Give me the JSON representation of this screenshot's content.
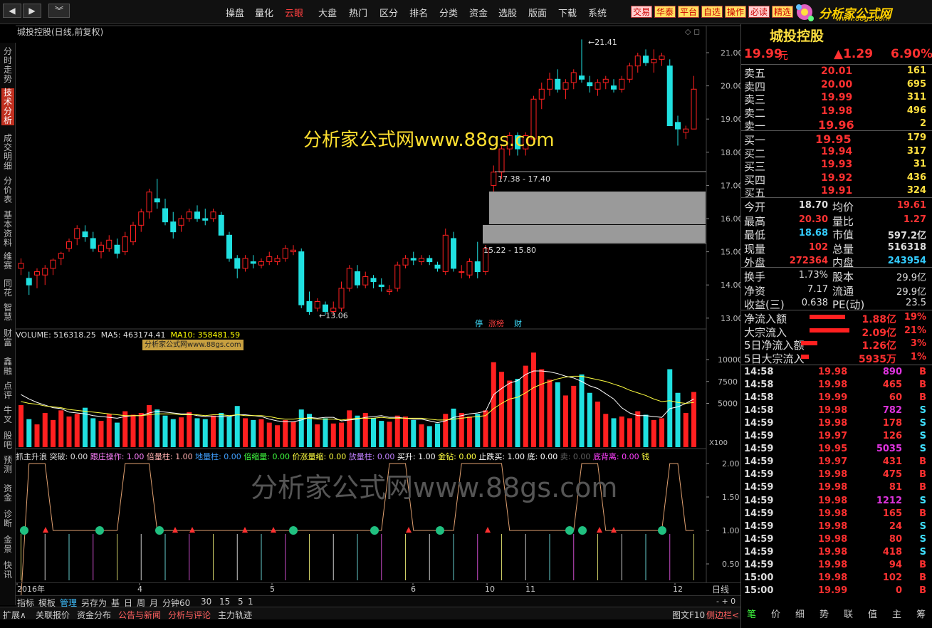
{
  "topbar": {
    "menu": [
      "操盘",
      "量化",
      "云眼",
      "大盘",
      "热门",
      "区分",
      "排名",
      "分类",
      "资金",
      "选股",
      "版面",
      "下载",
      "系统"
    ],
    "active_menu": "云眼",
    "quick": [
      "交易",
      "华泰",
      "平台",
      "自选",
      "操作",
      "必读",
      "精选"
    ],
    "logo": "分析家公式网",
    "logo_url": "www.88gs.com"
  },
  "sidebar": [
    "分时走势",
    "技术分析",
    "成交明细",
    "分价表",
    "基本资料",
    "维赛",
    "同花",
    "智慧",
    "财富",
    "鑫融",
    "点评",
    "牛叉",
    "股吧",
    "预测",
    "资金",
    "诊断",
    "金景",
    "快讯"
  ],
  "sidebar_active": "技术分析",
  "chart_title": "城投控股(日线,前复权)",
  "watermark": "分析家公式网www.88gs.com",
  "watermark2": "分析家公式网www.88gs.com",
  "volume_header": {
    "vol": "VOLUME: 516318.25",
    "ma5": "MA5: 463174.41",
    "ma10": "MA10: 358481.59",
    "badge": "分析家公式网www.88gs.com"
  },
  "annotations": {
    "high": "21.41",
    "low": "13.06",
    "zone1": "17.38 - 17.40",
    "zone2": "15.22 - 15.80",
    "x100": "X100"
  },
  "event_marks": [
    "停",
    "涨榜",
    "财"
  ],
  "indicator_header": [
    "抓主升浪",
    "突破: 0.00",
    "跟庄操作: 1.00",
    "倍量柱: 1.00",
    "地量柱: 0.00",
    "倍缩量: 0.00",
    "价涨量缩: 0.00",
    "放量柱: 0.00",
    "买升: 1.00",
    "金钻: 0.00",
    "止跌买: 1.00",
    "底: 0.00",
    "卖: 0.00",
    "底背离: 0.00",
    "钱"
  ],
  "chart_data": {
    "type": "candlestick",
    "price_ticks": [
      "21.00",
      "20.00",
      "19.00",
      "18.00",
      "17.00",
      "16.00",
      "15.00",
      "14.00",
      "13.00"
    ],
    "volume_ticks": [
      "10000",
      "7500",
      "5000"
    ],
    "indicator_ticks": [
      "2.00",
      "1.50",
      "1.00",
      "0.50"
    ],
    "x_labels": [
      "2016年",
      "4",
      "5",
      "6",
      "10",
      "11",
      "12"
    ],
    "ohlc": [
      [
        14.5,
        14.8,
        14.3,
        14.65
      ],
      [
        14.2,
        14.4,
        13.7,
        14.0
      ],
      [
        14.3,
        14.5,
        13.9,
        14.4
      ],
      [
        14.3,
        14.6,
        14.0,
        14.5
      ],
      [
        14.5,
        14.8,
        14.3,
        14.75
      ],
      [
        14.8,
        15.0,
        14.6,
        14.95
      ],
      [
        15.1,
        15.4,
        15.0,
        15.3
      ],
      [
        15.4,
        15.8,
        15.2,
        15.7
      ],
      [
        15.6,
        15.8,
        15.3,
        15.45
      ],
      [
        15.4,
        15.6,
        15.0,
        15.1
      ],
      [
        15.0,
        15.3,
        14.8,
        15.2
      ],
      [
        15.1,
        15.5,
        15.0,
        15.35
      ],
      [
        15.2,
        15.4,
        14.8,
        14.95
      ],
      [
        15.0,
        15.6,
        14.9,
        15.45
      ],
      [
        15.3,
        15.9,
        15.2,
        15.8
      ],
      [
        15.8,
        16.3,
        15.6,
        16.2
      ],
      [
        16.2,
        16.9,
        16.0,
        16.8
      ],
      [
        16.6,
        17.2,
        16.3,
        16.5
      ],
      [
        16.3,
        16.6,
        15.8,
        15.9
      ],
      [
        15.9,
        16.2,
        15.4,
        15.6
      ],
      [
        15.8,
        16.1,
        15.6,
        16.0
      ],
      [
        16.0,
        16.3,
        15.9,
        16.2
      ],
      [
        16.2,
        16.4,
        15.9,
        16.0
      ],
      [
        16.0,
        16.3,
        15.8,
        15.95
      ],
      [
        16.0,
        16.3,
        15.9,
        16.2
      ],
      [
        16.1,
        16.2,
        15.5,
        15.5
      ],
      [
        15.5,
        15.6,
        14.7,
        14.8
      ],
      [
        14.8,
        14.9,
        14.2,
        14.5
      ],
      [
        14.5,
        14.9,
        14.4,
        14.8
      ],
      [
        14.7,
        14.9,
        14.5,
        14.65
      ],
      [
        14.6,
        14.8,
        14.5,
        14.7
      ],
      [
        14.7,
        15.0,
        14.6,
        14.85
      ],
      [
        14.7,
        14.9,
        14.6,
        14.8
      ],
      [
        14.8,
        15.2,
        14.7,
        15.1
      ],
      [
        15.0,
        15.2,
        14.9,
        15.05
      ],
      [
        15.0,
        15.1,
        13.3,
        13.4
      ],
      [
        13.5,
        13.8,
        13.1,
        13.2
      ],
      [
        13.3,
        13.6,
        13.2,
        13.5
      ],
      [
        13.4,
        13.5,
        13.1,
        13.2
      ],
      [
        13.2,
        13.5,
        13.1,
        13.3
      ],
      [
        13.3,
        14.1,
        13.2,
        13.9
      ],
      [
        13.9,
        14.6,
        13.8,
        14.5
      ],
      [
        14.4,
        14.6,
        13.9,
        14.0
      ],
      [
        14.0,
        14.4,
        13.9,
        14.25
      ],
      [
        14.2,
        14.3,
        13.9,
        14.1
      ],
      [
        14.0,
        14.2,
        13.8,
        13.95
      ],
      [
        13.8,
        14.0,
        13.7,
        13.85
      ],
      [
        13.9,
        14.7,
        13.8,
        14.6
      ],
      [
        14.6,
        14.9,
        14.5,
        14.8
      ],
      [
        14.8,
        15.0,
        14.6,
        14.75
      ],
      [
        14.7,
        14.9,
        14.6,
        14.8
      ],
      [
        14.8,
        14.9,
        14.6,
        14.7
      ],
      [
        14.6,
        14.7,
        14.4,
        14.5
      ],
      [
        14.4,
        15.7,
        14.3,
        15.5
      ],
      [
        15.4,
        15.6,
        14.4,
        14.5
      ],
      [
        14.4,
        14.6,
        14.2,
        14.4
      ],
      [
        14.3,
        14.8,
        14.2,
        14.7
      ],
      [
        14.7,
        15.3,
        14.2,
        14.4
      ],
      [
        14.4,
        15.2,
        14.3,
        15.1
      ],
      [
        17.0,
        17.6,
        16.8,
        17.4
      ],
      [
        17.4,
        18.2,
        17.2,
        18.1
      ],
      [
        18.1,
        18.6,
        17.9,
        18.5
      ],
      [
        18.5,
        18.6,
        17.9,
        18.1
      ],
      [
        18.1,
        18.6,
        17.9,
        18.5
      ],
      [
        18.4,
        19.7,
        18.3,
        19.6
      ],
      [
        19.6,
        20.1,
        19.3,
        19.9
      ],
      [
        19.9,
        20.4,
        19.7,
        20.2
      ],
      [
        20.2,
        20.5,
        19.8,
        19.9
      ],
      [
        19.9,
        20.2,
        19.6,
        20.1
      ],
      [
        20.1,
        20.5,
        19.9,
        20.4
      ],
      [
        20.3,
        21.4,
        20.1,
        20.2
      ],
      [
        20.1,
        20.3,
        19.8,
        20.0
      ],
      [
        19.9,
        20.2,
        19.7,
        20.1
      ],
      [
        20.1,
        20.3,
        19.9,
        20.2
      ],
      [
        20.0,
        20.2,
        19.8,
        19.9
      ],
      [
        19.9,
        20.3,
        19.8,
        20.2
      ],
      [
        20.2,
        20.7,
        20.1,
        20.6
      ],
      [
        20.6,
        21.0,
        20.4,
        20.9
      ],
      [
        20.9,
        21.1,
        20.6,
        20.7
      ],
      [
        20.7,
        21.1,
        20.4,
        20.8
      ],
      [
        20.8,
        21.0,
        20.6,
        20.9
      ],
      [
        20.6,
        20.8,
        18.8,
        18.8
      ],
      [
        18.9,
        19.1,
        18.2,
        18.7
      ],
      [
        18.6,
        18.8,
        18.4,
        18.7
      ],
      [
        18.7,
        20.3,
        18.7,
        19.9
      ]
    ],
    "volume": [
      4800,
      3200,
      2600,
      3900,
      3100,
      4200,
      3500,
      3800,
      4500,
      3300,
      3000,
      3800,
      2800,
      4100,
      3700,
      3900,
      4800,
      4300,
      3600,
      3200,
      3400,
      4000,
      3300,
      3200,
      3600,
      3900,
      3500,
      4700,
      3300,
      3100,
      3200,
      2800,
      2500,
      3100,
      2900,
      4300,
      3800,
      2600,
      3300,
      2700,
      2800,
      4200,
      3600,
      3900,
      3300,
      3000,
      2900,
      3600,
      3500,
      3100,
      2600,
      2400,
      2700,
      3800,
      4400,
      3900,
      3500,
      3800,
      4200,
      9700,
      8600,
      7600,
      7800,
      9300,
      10800,
      8900,
      7700,
      7400,
      5900,
      7000,
      8300,
      6200,
      5200,
      3800,
      3300,
      3500,
      3300,
      4100,
      3700,
      3100,
      3300,
      8900,
      6200,
      3900,
      6300
    ],
    "ma5": [
      6000,
      5500,
      5100,
      4800,
      4500,
      4400,
      4000,
      3900,
      3800,
      3600,
      3500,
      3400,
      3300,
      3500,
      3600,
      3600,
      3900,
      4100,
      4000,
      3900,
      3800,
      3800,
      3600,
      3500,
      3500,
      3500,
      3500,
      3700,
      3700,
      3600,
      3500,
      3200,
      3000,
      2900,
      2900,
      3100,
      3400,
      3300,
      3400,
      3400,
      3000,
      3100,
      3200,
      3400,
      3500,
      3600,
      3400,
      3400,
      3300,
      3200,
      3200,
      3000,
      2800,
      3000,
      3400,
      3600,
      3800,
      3900,
      4100,
      6000,
      6700,
      7300,
      7600,
      8300,
      8700,
      8700,
      8600,
      8400,
      8100,
      7900,
      7500,
      7000,
      6700,
      6100,
      5500,
      4500,
      3900,
      3600,
      3600,
      3500,
      3400,
      4400,
      4600,
      5000,
      5500
    ],
    "ma10": [
      5200,
      5000,
      4900,
      4700,
      4600,
      4500,
      4300,
      4200,
      4100,
      4000,
      3900,
      3800,
      3700,
      3600,
      3600,
      3600,
      3700,
      3800,
      3800,
      3800,
      3700,
      3700,
      3700,
      3600,
      3700,
      3700,
      3600,
      3700,
      3600,
      3600,
      3600,
      3500,
      3300,
      3200,
      3200,
      3300,
      3300,
      3200,
      3200,
      3200,
      3100,
      3200,
      3300,
      3300,
      3300,
      3400,
      3300,
      3300,
      3300,
      3300,
      3300,
      3200,
      3100,
      3100,
      3200,
      3300,
      3400,
      3500,
      3600,
      4400,
      5000,
      5500,
      5700,
      6200,
      6800,
      7200,
      7500,
      7800,
      8000,
      8100,
      8100,
      7900,
      7700,
      7500,
      7200,
      6900,
      6500,
      6200,
      5900,
      5500,
      5200,
      5300,
      5100,
      5000,
      5100
    ],
    "indicator": [
      0,
      2,
      2,
      2,
      1,
      1,
      1,
      1,
      1,
      1,
      1,
      1,
      1,
      2,
      2,
      2,
      2,
      1,
      1,
      1,
      1,
      1,
      1,
      1,
      1,
      1,
      1,
      1,
      1,
      1,
      1,
      1,
      1,
      1,
      1,
      1,
      1,
      1,
      1,
      1,
      1,
      1,
      1,
      1,
      1,
      1,
      2,
      2,
      2,
      1,
      1,
      1,
      1,
      1,
      1,
      2,
      2,
      2,
      2,
      2,
      2,
      1,
      1,
      1,
      1,
      1,
      1,
      1,
      1,
      1,
      2,
      2,
      2,
      1,
      1,
      1,
      1,
      1,
      1,
      1,
      1,
      2,
      2,
      1,
      1
    ]
  },
  "right_panel": {
    "title": "城投控股",
    "price": "19.99",
    "price_unit": "元",
    "change": "▲1.29",
    "change_pct": "6.90%",
    "asks": [
      {
        "label": "卖五",
        "price": "20.01",
        "vol": "161"
      },
      {
        "label": "卖四",
        "price": "20.00",
        "vol": "695"
      },
      {
        "label": "卖三",
        "price": "19.99",
        "vol": "311"
      },
      {
        "label": "卖二",
        "price": "19.98",
        "vol": "496"
      },
      {
        "label": "卖一",
        "price": "19.96",
        "vol": "2"
      }
    ],
    "bids": [
      {
        "label": "买一",
        "price": "19.95",
        "vol": "179"
      },
      {
        "label": "买二",
        "price": "19.94",
        "vol": "317"
      },
      {
        "label": "买三",
        "price": "19.93",
        "vol": "31"
      },
      {
        "label": "买四",
        "price": "19.92",
        "vol": "436"
      },
      {
        "label": "买五",
        "price": "19.91",
        "vol": "324"
      }
    ],
    "stats": [
      [
        {
          "l": "今开",
          "v": "18.70",
          "c": "#ddd"
        },
        {
          "l": "均价",
          "v": "19.61",
          "c": "#f33"
        }
      ],
      [
        {
          "l": "最高",
          "v": "20.30",
          "c": "#f33"
        },
        {
          "l": "量比",
          "v": "1.27",
          "c": "#f33"
        }
      ],
      [
        {
          "l": "最低",
          "v": "18.68",
          "c": "#3cf"
        },
        {
          "l": "市值",
          "v": "597.2亿",
          "c": "#ddd"
        }
      ],
      [
        {
          "l": "现量",
          "v": "102",
          "c": "#f33"
        },
        {
          "l": "总量",
          "v": "516318",
          "c": "#ddd"
        }
      ],
      [
        {
          "l": "外盘",
          "v": "272364",
          "c": "#f33"
        },
        {
          "l": "内盘",
          "v": "243954",
          "c": "#3cf"
        }
      ]
    ],
    "stats2": [
      [
        {
          "l": "换手",
          "v": "1.73%"
        },
        {
          "l": "股本",
          "v": "29.9亿"
        }
      ],
      [
        {
          "l": "净资",
          "v": "7.17"
        },
        {
          "l": "流通",
          "v": "29.9亿"
        }
      ],
      [
        {
          "l": "收益(三)",
          "v": "0.638"
        },
        {
          "l": "PE(动)",
          "v": "23.5"
        }
      ]
    ],
    "flows": [
      {
        "l": "净流入额",
        "v": "1.88亿",
        "p": "19%",
        "w": 0.55
      },
      {
        "l": "大宗流入",
        "v": "2.09亿",
        "p": "21%",
        "w": 0.62
      },
      {
        "l": "5日净流入额",
        "v": "1.26亿",
        "p": "3%",
        "w": 0.25
      },
      {
        "l": "5日大宗流入",
        "v": "5935万",
        "p": "1%",
        "w": 0.12
      }
    ],
    "ticks": [
      {
        "t": "14:58",
        "p": "19.98",
        "v": "890",
        "s": "B",
        "c": "#d3d"
      },
      {
        "t": "14:58",
        "p": "19.98",
        "v": "465",
        "s": "B",
        "c": "#f33"
      },
      {
        "t": "14:58",
        "p": "19.99",
        "v": "60",
        "s": "B",
        "c": "#f33"
      },
      {
        "t": "14:58",
        "p": "19.98",
        "v": "782",
        "s": "S",
        "c": "#d3d"
      },
      {
        "t": "14:59",
        "p": "19.98",
        "v": "178",
        "s": "S",
        "c": "#f33"
      },
      {
        "t": "14:59",
        "p": "19.97",
        "v": "126",
        "s": "S",
        "c": "#f33"
      },
      {
        "t": "14:59",
        "p": "19.95",
        "v": "5035",
        "s": "S",
        "c": "#d3d"
      },
      {
        "t": "14:59",
        "p": "19.97",
        "v": "431",
        "s": "B",
        "c": "#f33"
      },
      {
        "t": "14:59",
        "p": "19.98",
        "v": "475",
        "s": "B",
        "c": "#f33"
      },
      {
        "t": "14:59",
        "p": "19.98",
        "v": "81",
        "s": "B",
        "c": "#f33"
      },
      {
        "t": "14:59",
        "p": "19.98",
        "v": "1212",
        "s": "S",
        "c": "#d3d"
      },
      {
        "t": "14:59",
        "p": "19.98",
        "v": "165",
        "s": "B",
        "c": "#f33"
      },
      {
        "t": "14:59",
        "p": "19.98",
        "v": "24",
        "s": "S",
        "c": "#f33"
      },
      {
        "t": "14:59",
        "p": "19.98",
        "v": "80",
        "s": "S",
        "c": "#f33"
      },
      {
        "t": "14:59",
        "p": "19.98",
        "v": "418",
        "s": "S",
        "c": "#f33"
      },
      {
        "t": "14:59",
        "p": "19.98",
        "v": "94",
        "s": "B",
        "c": "#f33"
      },
      {
        "t": "15:00",
        "p": "19.98",
        "v": "102",
        "s": "B",
        "c": "#f33"
      },
      {
        "t": "15:00",
        "p": "19.99",
        "v": "0",
        "s": "B",
        "c": "#f33"
      }
    ],
    "bottom_tabs": [
      "笔",
      "价",
      "细",
      "势",
      "联",
      "值",
      "主",
      "筹"
    ]
  },
  "bottom": {
    "row1": [
      "指标",
      "模板",
      "管理",
      "另存为",
      "基",
      "日",
      "周",
      "月",
      "分钟60",
      "30",
      "15",
      "5",
      "1"
    ],
    "row2": [
      "扩展∧",
      "关联报价",
      "资金分布",
      "公告与新闻",
      "分析与评论",
      "主力轨迹"
    ],
    "period": "日线",
    "right_tools": [
      "图文F10",
      "侧边栏<"
    ]
  },
  "colors": {
    "up": "#ff2020",
    "down": "#20e0e0",
    "ma5": "#ffffff",
    "ma10": "#ffff40",
    "accent": "#ff4040"
  }
}
